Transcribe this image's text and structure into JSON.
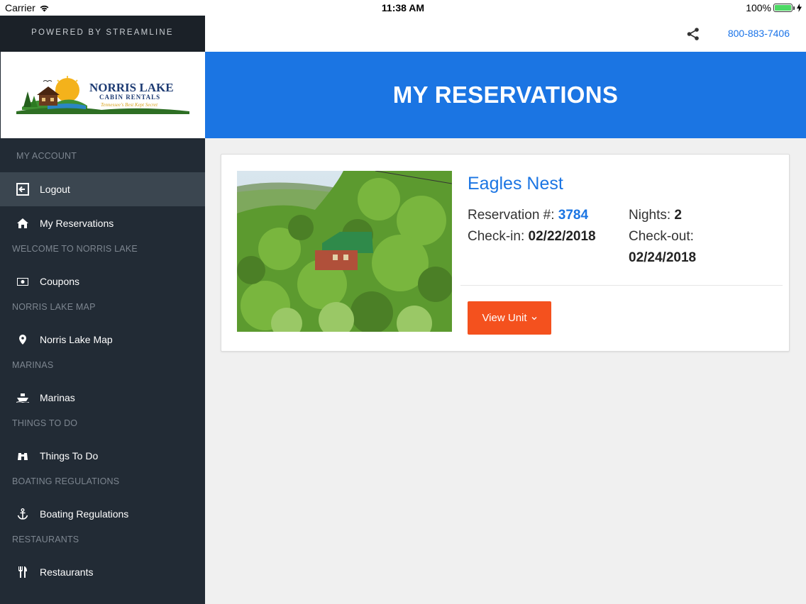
{
  "status_bar": {
    "carrier": "Carrier",
    "time": "11:38 AM",
    "battery": "100%",
    "battery_level": 1.0
  },
  "sidebar": {
    "powered_by": "POWERED BY STREAMLINE",
    "logo": {
      "title": "NORRIS LAKE",
      "subtitle": "CABIN RENTALS",
      "tagline": "Tennessee's Best Kept Secret"
    },
    "sections": [
      {
        "label": "MY ACCOUNT",
        "items": [
          {
            "label": "Logout",
            "icon": "logout-icon",
            "active": true
          },
          {
            "label": "My Reservations",
            "icon": "home-icon"
          }
        ]
      },
      {
        "label": "WELCOME TO NORRIS LAKE",
        "items": [
          {
            "label": "Coupons",
            "icon": "coupon-icon"
          }
        ]
      },
      {
        "label": "NORRIS LAKE MAP",
        "items": [
          {
            "label": "Norris Lake Map",
            "icon": "map-pin-icon"
          }
        ]
      },
      {
        "label": "MARINAS",
        "items": [
          {
            "label": "Marinas",
            "icon": "boat-icon"
          }
        ]
      },
      {
        "label": "THINGS TO DO",
        "items": [
          {
            "label": "Things To Do",
            "icon": "binoculars-icon"
          }
        ]
      },
      {
        "label": "BOATING REGULATIONS",
        "items": [
          {
            "label": "Boating Regulations",
            "icon": "anchor-icon"
          }
        ]
      },
      {
        "label": "RESTAURANTS",
        "items": [
          {
            "label": "Restaurants",
            "icon": "utensils-icon"
          }
        ]
      }
    ]
  },
  "header": {
    "phone": "800-883-7406",
    "share_icon": "share-icon"
  },
  "banner": {
    "title": "MY RESERVATIONS"
  },
  "reservation": {
    "unit_name": "Eagles Nest",
    "reservation_label": "Reservation #:",
    "reservation_number": "3784",
    "nights_label": "Nights:",
    "nights": "2",
    "checkin_label": "Check-in:",
    "checkin": "02/22/2018",
    "checkout_label": "Check-out:",
    "checkout": "02/24/2018",
    "view_button": "View Unit"
  },
  "colors": {
    "primary_blue": "#1b75e3",
    "sidebar_bg": "#222b35",
    "button_orange": "#f4511e"
  }
}
